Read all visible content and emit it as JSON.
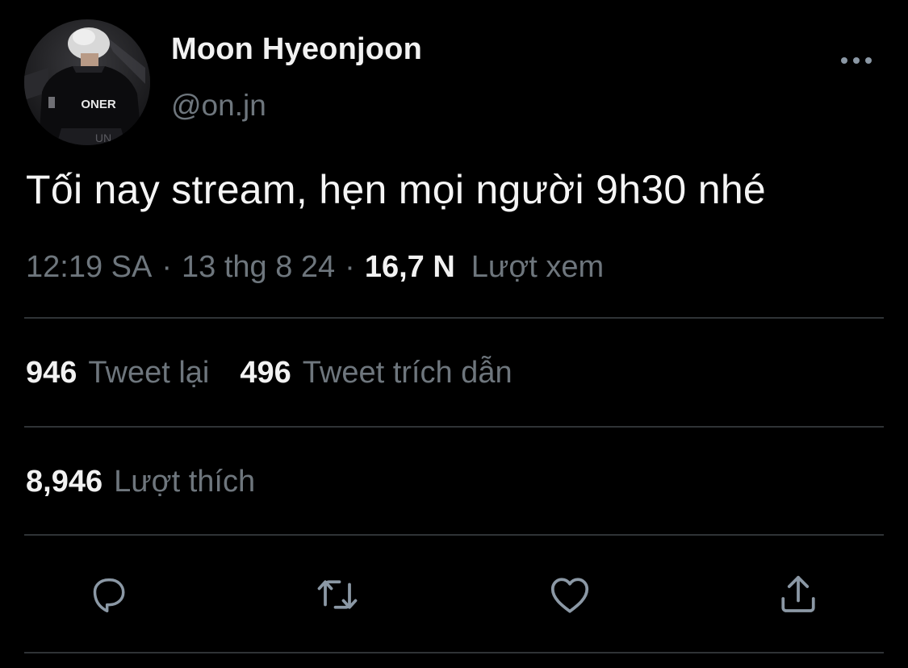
{
  "author": {
    "display_name": "Moon Hyeonjoon",
    "handle": "@on.jn",
    "avatar_jersey_text": "ONER"
  },
  "tweet": {
    "text": "Tối nay stream, hẹn mọi người 9h30 nhé"
  },
  "meta": {
    "time": "12:19 SA",
    "separator": "·",
    "date": "13 thg 8 24",
    "views_count": "16,7 N",
    "views_label": "Lượt xem"
  },
  "stats": {
    "retweets_count": "946",
    "retweets_label": "Tweet lại",
    "quotes_count": "496",
    "quotes_label": "Tweet trích dẫn",
    "likes_count": "8,946",
    "likes_label": "Lượt thích"
  },
  "actions": [
    {
      "name": "reply",
      "icon": "reply-icon"
    },
    {
      "name": "retweet",
      "icon": "retweet-icon"
    },
    {
      "name": "like",
      "icon": "heart-icon"
    },
    {
      "name": "share",
      "icon": "share-icon"
    }
  ],
  "colors": {
    "background": "#000000",
    "text_primary": "#f2f2f2",
    "text_secondary": "#6e767d",
    "divider": "#2f3336",
    "icon": "#8b98a5"
  }
}
